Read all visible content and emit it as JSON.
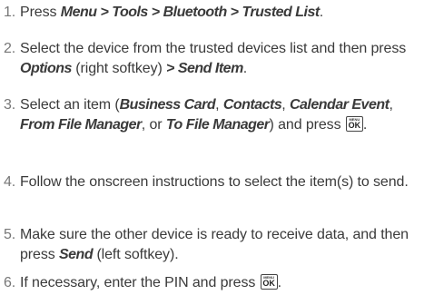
{
  "steps": [
    {
      "num": "1.",
      "t1": "Press ",
      "e1": "Menu > Tools > Bluetooth > Trusted List",
      "t2": "."
    },
    {
      "num": "2.",
      "t1": "Select the device from the trusted devices list and then press ",
      "e1": "Options",
      "t2": " (right softkey) ",
      "e2": "> Send Item",
      "t3": "."
    },
    {
      "num": "3.",
      "t1": "Select an item (",
      "e1": "Business Card",
      "t2": ", ",
      "e2": "Contacts",
      "t3": ", ",
      "e3": "Calendar Event",
      "t4": ", ",
      "e4": "From File Manager",
      "t5": ", or ",
      "e5": "To File Manager",
      "t6": ") and press ",
      "t7": "."
    },
    {
      "num": "4.",
      "t1": "Follow the onscreen instructions to select the item(s) to send."
    },
    {
      "num": "5.",
      "t1": "Make sure the other device is ready to receive data, and then press ",
      "e1": "Send",
      "t2": " (left softkey)."
    },
    {
      "num": "6.",
      "t1": "If necessary, enter the PIN and press ",
      "t2": "."
    }
  ],
  "key": {
    "top": "MENU",
    "main": "OK"
  }
}
